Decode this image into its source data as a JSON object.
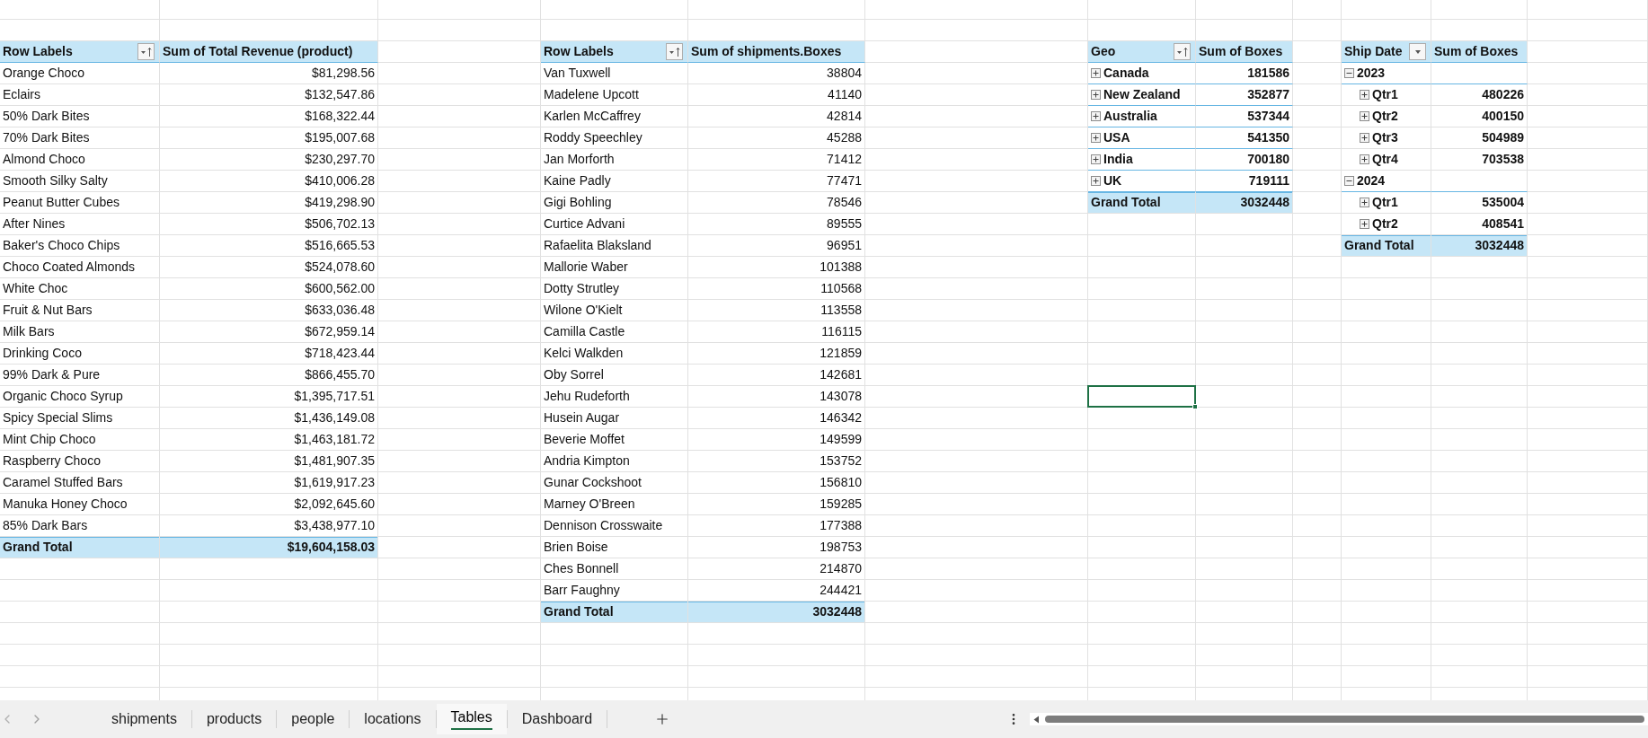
{
  "pivot_tables": [
    {
      "headers": [
        "Row Labels",
        "Sum of Total Revenue (product)"
      ],
      "sorted": true,
      "rows": [
        {
          "label": "Orange Choco",
          "value": "$81,298.56"
        },
        {
          "label": "Eclairs",
          "value": "$132,547.86"
        },
        {
          "label": "50% Dark Bites",
          "value": "$168,322.44"
        },
        {
          "label": "70% Dark Bites",
          "value": "$195,007.68"
        },
        {
          "label": "Almond Choco",
          "value": "$230,297.70"
        },
        {
          "label": "Smooth Silky Salty",
          "value": "$410,006.28"
        },
        {
          "label": "Peanut Butter Cubes",
          "value": "$419,298.90"
        },
        {
          "label": "After Nines",
          "value": "$506,702.13"
        },
        {
          "label": "Baker's Choco Chips",
          "value": "$516,665.53"
        },
        {
          "label": "Choco Coated Almonds",
          "value": "$524,078.60"
        },
        {
          "label": "White Choc",
          "value": "$600,562.00"
        },
        {
          "label": "Fruit & Nut Bars",
          "value": "$633,036.48"
        },
        {
          "label": "Milk Bars",
          "value": "$672,959.14"
        },
        {
          "label": "Drinking Coco",
          "value": "$718,423.44"
        },
        {
          "label": "99% Dark & Pure",
          "value": "$866,455.70"
        },
        {
          "label": "Organic Choco Syrup",
          "value": "$1,395,717.51"
        },
        {
          "label": "Spicy Special Slims",
          "value": "$1,436,149.08"
        },
        {
          "label": "Mint Chip Choco",
          "value": "$1,463,181.72"
        },
        {
          "label": "Raspberry Choco",
          "value": "$1,481,907.35"
        },
        {
          "label": "Caramel Stuffed Bars",
          "value": "$1,619,917.23"
        },
        {
          "label": "Manuka Honey Choco",
          "value": "$2,092,645.60"
        },
        {
          "label": "85% Dark Bars",
          "value": "$3,438,977.10"
        }
      ],
      "grand_total": {
        "label": "Grand Total",
        "value": "$19,604,158.03"
      }
    },
    {
      "headers": [
        "Row Labels",
        "Sum of shipments.Boxes"
      ],
      "sorted": true,
      "rows": [
        {
          "label": "Van Tuxwell",
          "value": "38804"
        },
        {
          "label": "Madelene Upcott",
          "value": "41140"
        },
        {
          "label": "Karlen McCaffrey",
          "value": "42814"
        },
        {
          "label": "Roddy Speechley",
          "value": "45288"
        },
        {
          "label": "Jan Morforth",
          "value": "71412"
        },
        {
          "label": "Kaine Padly",
          "value": "77471"
        },
        {
          "label": "Gigi Bohling",
          "value": "78546"
        },
        {
          "label": "Curtice Advani",
          "value": "89555"
        },
        {
          "label": "Rafaelita Blaksland",
          "value": "96951"
        },
        {
          "label": "Mallorie Waber",
          "value": "101388"
        },
        {
          "label": "Dotty Strutley",
          "value": "110568"
        },
        {
          "label": "Wilone O'Kielt",
          "value": "113558"
        },
        {
          "label": "Camilla Castle",
          "value": "116115"
        },
        {
          "label": "Kelci Walkden",
          "value": "121859"
        },
        {
          "label": "Oby Sorrel",
          "value": "142681"
        },
        {
          "label": "Jehu Rudeforth",
          "value": "143078"
        },
        {
          "label": "Husein Augar",
          "value": "146342"
        },
        {
          "label": "Beverie Moffet",
          "value": "149599"
        },
        {
          "label": "Andria Kimpton",
          "value": "153752"
        },
        {
          "label": "Gunar Cockshoot",
          "value": "156810"
        },
        {
          "label": "Marney O'Breen",
          "value": "159285"
        },
        {
          "label": "Dennison Crosswaite",
          "value": "177388"
        },
        {
          "label": "Brien Boise",
          "value": "198753"
        },
        {
          "label": "Ches Bonnell",
          "value": "214870"
        },
        {
          "label": "Barr Faughny",
          "value": "244421"
        }
      ],
      "grand_total": {
        "label": "Grand Total",
        "value": "3032448"
      }
    },
    {
      "headers": [
        "Geo",
        "Sum of Boxes"
      ],
      "sorted": true,
      "rows": [
        {
          "label": "Canada",
          "value": "181586",
          "expanded": false
        },
        {
          "label": "New Zealand",
          "value": "352877",
          "expanded": false
        },
        {
          "label": "Australia",
          "value": "537344",
          "expanded": false
        },
        {
          "label": "USA",
          "value": "541350",
          "expanded": false
        },
        {
          "label": "India",
          "value": "700180",
          "expanded": false
        },
        {
          "label": "UK",
          "value": "719111",
          "expanded": false
        }
      ],
      "grand_total": {
        "label": "Grand Total",
        "value": "3032448"
      }
    },
    {
      "headers": [
        "Ship Date",
        "Sum of Boxes"
      ],
      "sorted": false,
      "rows": [
        {
          "label": "2023",
          "expanded": true,
          "children": [
            {
              "label": "Qtr1",
              "value": "480226",
              "expanded": false
            },
            {
              "label": "Qtr2",
              "value": "400150",
              "expanded": false
            },
            {
              "label": "Qtr3",
              "value": "504989",
              "expanded": false
            },
            {
              "label": "Qtr4",
              "value": "703538",
              "expanded": false
            }
          ]
        },
        {
          "label": "2024",
          "expanded": true,
          "children": [
            {
              "label": "Qtr1",
              "value": "535004",
              "expanded": false
            },
            {
              "label": "Qtr2",
              "value": "408541",
              "expanded": false
            }
          ]
        }
      ],
      "grand_total": {
        "label": "Grand Total",
        "value": "3032448"
      }
    }
  ],
  "cell_selected": true,
  "sheet_tabs": [
    {
      "label": "shipments",
      "selected": false
    },
    {
      "label": "products",
      "selected": false
    },
    {
      "label": "people",
      "selected": false
    },
    {
      "label": "locations",
      "selected": false
    },
    {
      "label": "Tables",
      "selected": true
    },
    {
      "label": "Dashboard",
      "selected": false
    }
  ]
}
